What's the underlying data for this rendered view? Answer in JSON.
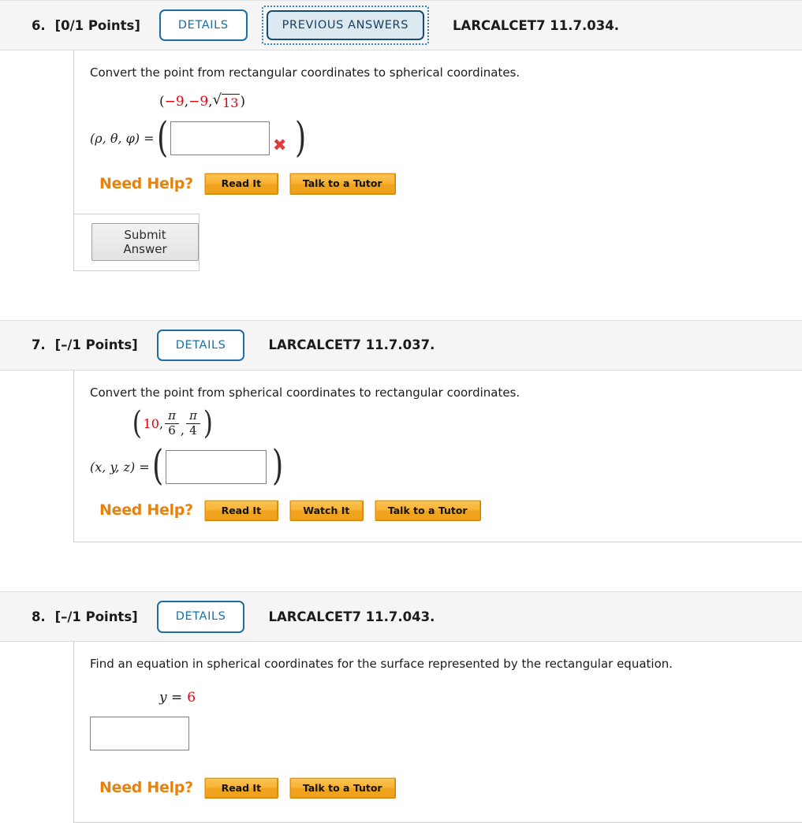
{
  "problems": [
    {
      "number": "6.",
      "points": "[0/1 Points]",
      "details_label": "DETAILS",
      "previous_answers_label": "PREVIOUS ANSWERS",
      "code": "LARCALCET7 11.7.034.",
      "has_previous_answers": true,
      "question": "Convert the point from rectangular coordinates to spherical coordinates.",
      "given_point": {
        "open": "(",
        "x": "−9",
        "sep1": ", ",
        "y": "−9",
        "sep2": ", ",
        "radical_sign": "√",
        "radicand": "13",
        "close": ")"
      },
      "answer_lhs": "(ρ, θ, φ)  =",
      "answer_value": "",
      "mark": "✖",
      "has_mark": true,
      "help_label": "Need Help?",
      "help_buttons": [
        "Read It",
        "Talk to a Tutor"
      ],
      "submit_label": "Submit Answer",
      "has_submit": true
    },
    {
      "number": "7.",
      "points": "[–/1 Points]",
      "details_label": "DETAILS",
      "code": "LARCALCET7 11.7.037.",
      "has_previous_answers": false,
      "question": "Convert the point from spherical coordinates to rectangular coordinates.",
      "given_point": {
        "open": "(",
        "rho": "10",
        "sep1": ", ",
        "frac1_num": "π",
        "frac1_den": "6",
        "sep2": ", ",
        "frac2_num": "π",
        "frac2_den": "4",
        "close": ")"
      },
      "answer_lhs": "(x, y, z)  =",
      "answer_value": "",
      "has_mark": false,
      "help_label": "Need Help?",
      "help_buttons": [
        "Read It",
        "Watch It",
        "Talk to a Tutor"
      ],
      "has_submit": false
    },
    {
      "number": "8.",
      "points": "[–/1 Points]",
      "details_label": "DETAILS",
      "code": "LARCALCET7 11.7.043.",
      "has_previous_answers": false,
      "question": "Find an equation in spherical coordinates for the surface represented by the rectangular equation.",
      "equation_lhs": "y  =",
      "equation_rhs": "6",
      "answer_value": "",
      "has_mark": false,
      "help_label": "Need Help?",
      "help_buttons": [
        "Read It",
        "Talk to a Tutor"
      ],
      "has_submit": false
    }
  ],
  "colors": {
    "accent_blue": "#1c6ea4",
    "help_orange": "#e8820c",
    "value_red": "#e8000d",
    "mark_red": "#e23b3b",
    "header_bg": "#f5f5f5",
    "border_gray": "#cfcfcf"
  }
}
